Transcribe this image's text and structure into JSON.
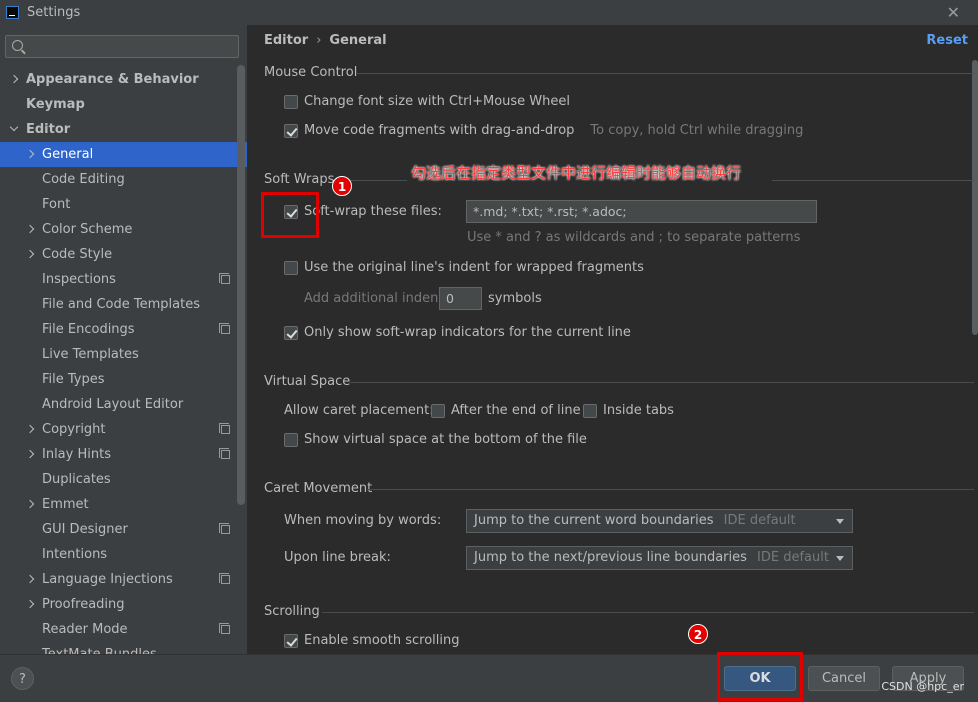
{
  "window": {
    "title": "Settings",
    "close": "✕"
  },
  "search": {
    "placeholder": ""
  },
  "sidebar": {
    "items": [
      {
        "label": "Appearance & Behavior",
        "indent": 0,
        "chevron": "right",
        "bold": true,
        "copy": false
      },
      {
        "label": "Keymap",
        "indent": 0,
        "chevron": "",
        "bold": true,
        "copy": false
      },
      {
        "label": "Editor",
        "indent": 0,
        "chevron": "down",
        "bold": true,
        "copy": false
      },
      {
        "label": "General",
        "indent": 1,
        "chevron": "right",
        "bold": false,
        "copy": false,
        "selected": true
      },
      {
        "label": "Code Editing",
        "indent": 1,
        "chevron": "",
        "bold": false,
        "copy": false
      },
      {
        "label": "Font",
        "indent": 1,
        "chevron": "",
        "bold": false,
        "copy": false
      },
      {
        "label": "Color Scheme",
        "indent": 1,
        "chevron": "right",
        "bold": false,
        "copy": false
      },
      {
        "label": "Code Style",
        "indent": 1,
        "chevron": "right",
        "bold": false,
        "copy": false
      },
      {
        "label": "Inspections",
        "indent": 1,
        "chevron": "",
        "bold": false,
        "copy": true
      },
      {
        "label": "File and Code Templates",
        "indent": 1,
        "chevron": "",
        "bold": false,
        "copy": false
      },
      {
        "label": "File Encodings",
        "indent": 1,
        "chevron": "",
        "bold": false,
        "copy": true
      },
      {
        "label": "Live Templates",
        "indent": 1,
        "chevron": "",
        "bold": false,
        "copy": false
      },
      {
        "label": "File Types",
        "indent": 1,
        "chevron": "",
        "bold": false,
        "copy": false
      },
      {
        "label": "Android Layout Editor",
        "indent": 1,
        "chevron": "",
        "bold": false,
        "copy": false
      },
      {
        "label": "Copyright",
        "indent": 1,
        "chevron": "right",
        "bold": false,
        "copy": true
      },
      {
        "label": "Inlay Hints",
        "indent": 1,
        "chevron": "right",
        "bold": false,
        "copy": true
      },
      {
        "label": "Duplicates",
        "indent": 1,
        "chevron": "",
        "bold": false,
        "copy": false
      },
      {
        "label": "Emmet",
        "indent": 1,
        "chevron": "right",
        "bold": false,
        "copy": false
      },
      {
        "label": "GUI Designer",
        "indent": 1,
        "chevron": "",
        "bold": false,
        "copy": true
      },
      {
        "label": "Intentions",
        "indent": 1,
        "chevron": "",
        "bold": false,
        "copy": false
      },
      {
        "label": "Language Injections",
        "indent": 1,
        "chevron": "right",
        "bold": false,
        "copy": true
      },
      {
        "label": "Proofreading",
        "indent": 1,
        "chevron": "right",
        "bold": false,
        "copy": false
      },
      {
        "label": "Reader Mode",
        "indent": 1,
        "chevron": "",
        "bold": false,
        "copy": true
      },
      {
        "label": "TextMate Bundles",
        "indent": 1,
        "chevron": "",
        "bold": false,
        "copy": false
      }
    ]
  },
  "breadcrumb": {
    "parent": "Editor",
    "separator": "›",
    "current": "General"
  },
  "reset_label": "Reset",
  "mouse_control": {
    "title": "Mouse Control",
    "change_font_size": "Change font size with Ctrl+Mouse Wheel",
    "change_font_size_checked": false,
    "move_fragments": "Move code fragments with drag-and-drop",
    "move_fragments_checked": true,
    "move_hint": "To copy, hold Ctrl while dragging"
  },
  "soft_wraps": {
    "title": "Soft Wraps",
    "soft_wrap_files": "Soft-wrap these files:",
    "soft_wrap_checked": true,
    "patterns_value": "*.md; *.txt; *.rst; *.adoc;",
    "patterns_hint": "Use * and ? as wildcards and ; to separate patterns",
    "original_indent": "Use the original line's indent for wrapped fragments",
    "original_indent_checked": false,
    "additional_indent_label": "Add additional indent:",
    "additional_indent_value": "0",
    "symbols_label": "symbols",
    "only_current_line": "Only show soft-wrap indicators for the current line",
    "only_current_line_checked": true
  },
  "virtual_space": {
    "title": "Virtual Space",
    "allow_caret_label": "Allow caret placement:",
    "after_end_of_line": "After the end of line",
    "after_end_checked": false,
    "inside_tabs": "Inside tabs",
    "inside_tabs_checked": false,
    "show_virtual_space": "Show virtual space at the bottom of the file",
    "show_virtual_checked": false
  },
  "caret_movement": {
    "title": "Caret Movement",
    "moving_by_words_label": "When moving by words:",
    "moving_by_words_value": "Jump to the current word boundaries",
    "moving_by_words_default": "IDE default",
    "line_break_label": "Upon line break:",
    "line_break_value": "Jump to the next/previous line boundaries",
    "line_break_default": "IDE default"
  },
  "scrolling": {
    "title": "Scrolling",
    "smooth_scrolling": "Enable smooth scrolling",
    "smooth_scrolling_checked": true
  },
  "annotation": {
    "text": "勾选后在指定类型文件中进行编辑时能够自动换行",
    "badge1": "1",
    "badge2": "2",
    "color": "#e00000"
  },
  "footer": {
    "help": "?",
    "ok": "OK",
    "cancel": "Cancel",
    "apply": "Apply",
    "watermark": "CSDN @hpc_er"
  },
  "colors": {
    "selection": "#2f65ca",
    "link": "#589df6"
  }
}
